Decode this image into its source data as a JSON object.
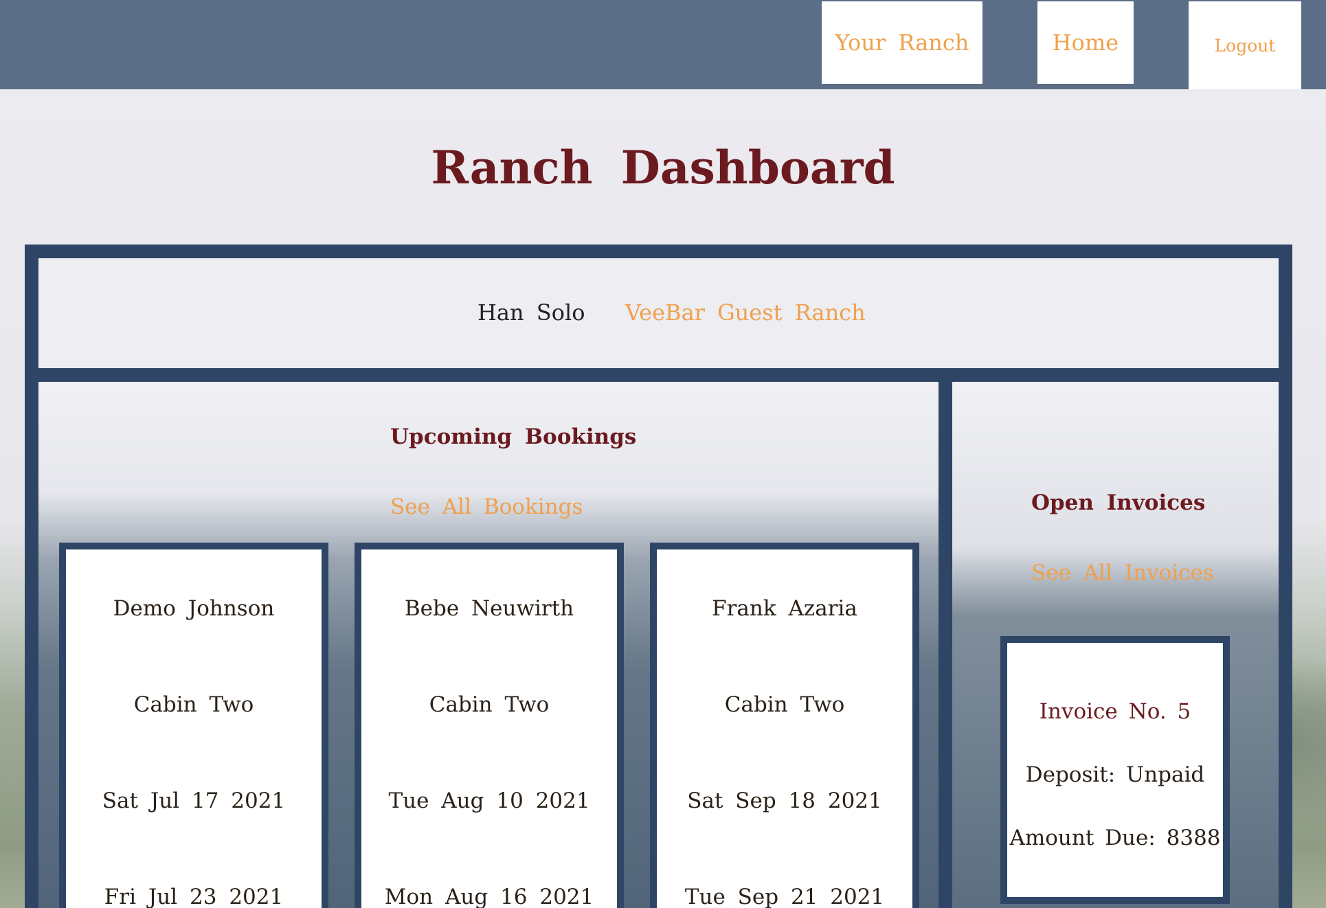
{
  "nav": {
    "your_ranch": "Your Ranch",
    "home": "Home",
    "logout": "Logout"
  },
  "page": {
    "title": "Ranch Dashboard"
  },
  "header": {
    "user_name": "Han Solo",
    "ranch_name": "VeeBar Guest Ranch"
  },
  "bookings": {
    "title": "Upcoming Bookings",
    "see_all": "See All Bookings",
    "items": [
      {
        "guest": "Demo Johnson",
        "cabin": "Cabin Two",
        "start": "Sat Jul 17 2021",
        "end": "Fri Jul 23 2021"
      },
      {
        "guest": "Bebe Neuwirth",
        "cabin": "Cabin Two",
        "start": "Tue Aug 10 2021",
        "end": "Mon Aug 16 2021"
      },
      {
        "guest": "Frank Azaria",
        "cabin": "Cabin Two",
        "start": "Sat Sep 18 2021",
        "end": "Tue Sep 21 2021"
      }
    ]
  },
  "invoices": {
    "title": "Open Invoices",
    "see_all": "See All Invoices",
    "items": [
      {
        "title": "Invoice No. 5",
        "deposit": "Deposit: Unpaid",
        "amount": "Amount Due: 8388"
      }
    ]
  },
  "colors": {
    "navbar": "#5c6d88",
    "accent_orange": "#f0a04b",
    "heading_maroon": "#6b1a1f",
    "frame_navy": "#2f4566"
  }
}
